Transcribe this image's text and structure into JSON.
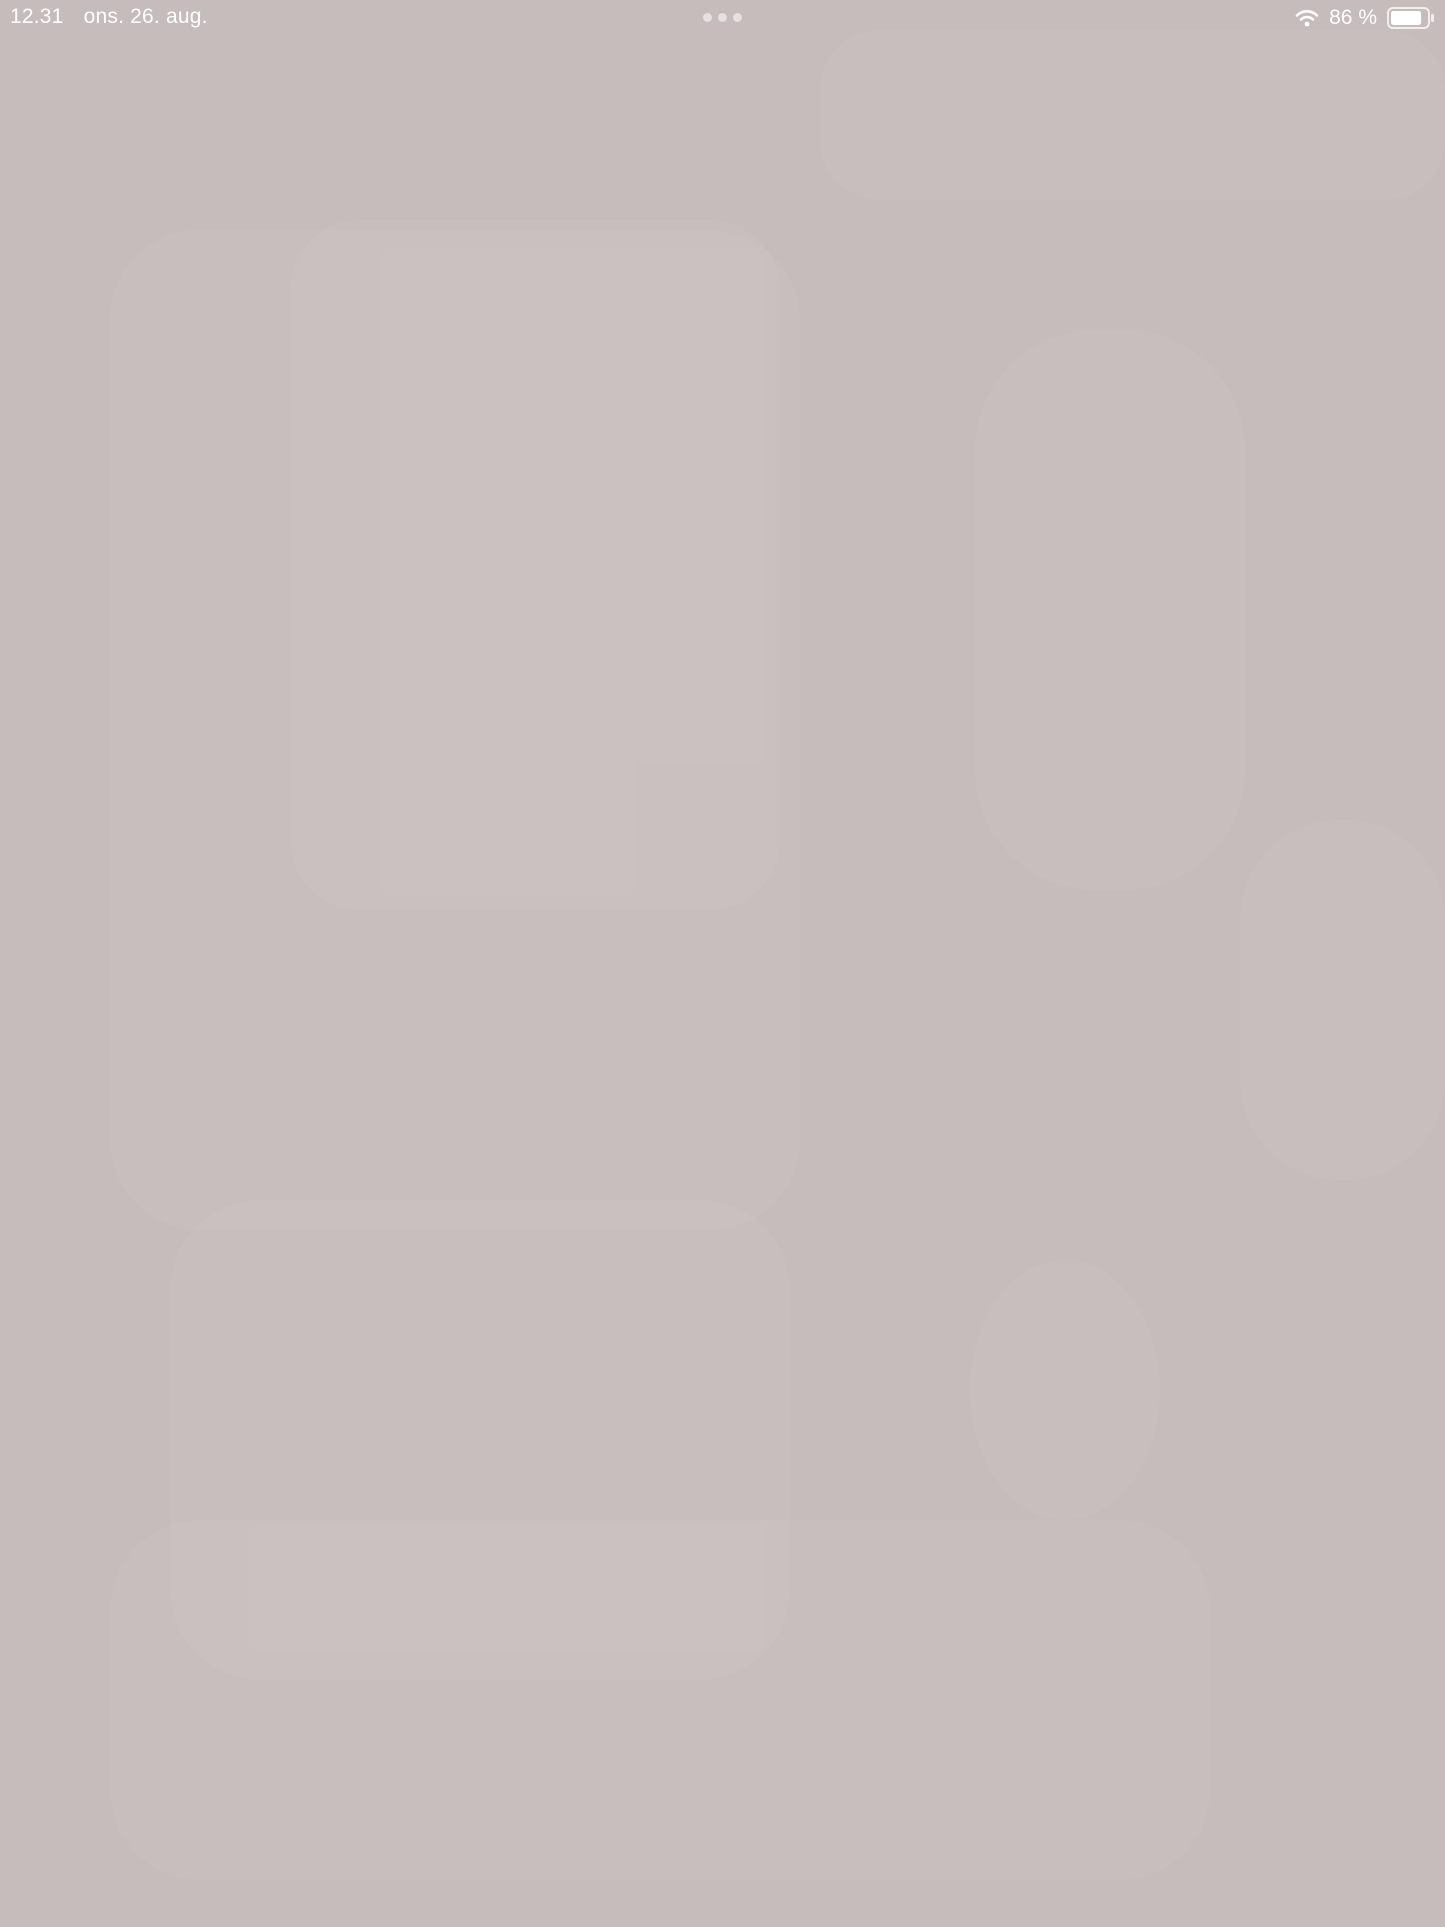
{
  "status_bar": {
    "time": "12.31",
    "date": "ons. 26. aug.",
    "battery_percent_label": "86 %",
    "battery_level": 0.86,
    "icons": [
      "wifi-icon",
      "battery-icon"
    ]
  },
  "multitasking_indicator": {
    "icon": "multitasking-dots-icon",
    "dot_count": 3
  },
  "colors": {
    "wallpaper": "#c6bcbb",
    "status_text": "#ffffff"
  }
}
